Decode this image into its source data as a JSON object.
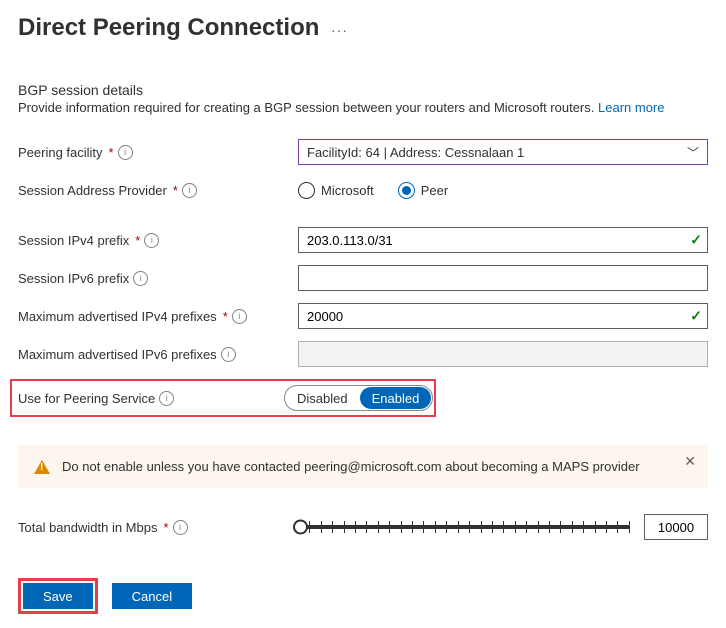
{
  "header": {
    "title": "Direct Peering Connection"
  },
  "section": {
    "heading": "BGP session details",
    "sub": "Provide information required for creating a BGP session between your routers and Microsoft routers. ",
    "learn": "Learn more"
  },
  "labels": {
    "facility": "Peering facility",
    "sap": "Session Address Provider",
    "ipv4": "Session IPv4 prefix",
    "ipv6": "Session IPv6 prefix",
    "max4": "Maximum advertised IPv4 prefixes",
    "max6": "Maximum advertised IPv6 prefixes",
    "ufps": "Use for Peering Service",
    "bw": "Total bandwidth in Mbps"
  },
  "values": {
    "facility": "FacilityId: 64 | Address: Cessnalaan 1",
    "sap_ms": "Microsoft",
    "sap_peer": "Peer",
    "ipv4": "203.0.113.0/31",
    "ipv6": "",
    "max4": "20000",
    "bw": "10000"
  },
  "toggle": {
    "off": "Disabled",
    "on": "Enabled"
  },
  "alert": {
    "text": "Do not enable unless you have contacted peering@microsoft.com about becoming a MAPS provider"
  },
  "buttons": {
    "save": "Save",
    "cancel": "Cancel"
  }
}
